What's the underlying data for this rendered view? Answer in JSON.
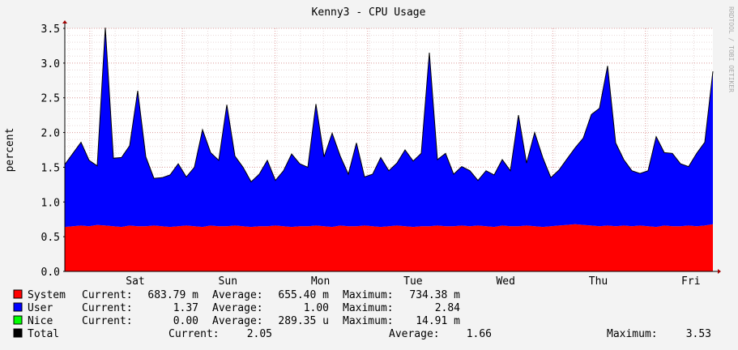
{
  "chart_data": {
    "type": "area",
    "title": "Kenny3 - CPU Usage",
    "ylabel": "percent",
    "watermark": "RRDTOOL / TOBI OETIKER",
    "ylim": [
      0,
      3.5
    ],
    "y_ticks": [
      "0.0",
      "0.5",
      "1.0",
      "1.5",
      "2.0",
      "2.5",
      "3.0",
      "3.5"
    ],
    "x_ticks": [
      "Sat",
      "Sun",
      "Mon",
      "Tue",
      "Wed",
      "Thu",
      "Fri"
    ],
    "grid": true,
    "stacked": true,
    "series": [
      {
        "name": "System",
        "color": "#ff0000",
        "current": "683.79 m",
        "average": "655.40 m",
        "maximum": "734.38 m",
        "values": [
          0.64,
          0.65,
          0.66,
          0.65,
          0.67,
          0.66,
          0.65,
          0.64,
          0.66,
          0.65,
          0.65,
          0.66,
          0.65,
          0.64,
          0.65,
          0.66,
          0.65,
          0.64,
          0.66,
          0.65,
          0.65,
          0.66,
          0.65,
          0.64,
          0.65,
          0.65,
          0.66,
          0.65,
          0.64,
          0.65,
          0.65,
          0.66,
          0.65,
          0.64,
          0.66,
          0.65,
          0.65,
          0.66,
          0.65,
          0.64,
          0.65,
          0.66,
          0.65,
          0.64,
          0.65,
          0.65,
          0.66,
          0.65,
          0.65,
          0.66,
          0.65,
          0.66,
          0.65,
          0.64,
          0.66,
          0.65,
          0.65,
          0.66,
          0.65,
          0.64,
          0.65,
          0.66,
          0.67,
          0.68,
          0.67,
          0.66,
          0.65,
          0.66,
          0.65,
          0.66,
          0.65,
          0.66,
          0.65,
          0.64,
          0.66,
          0.65,
          0.65,
          0.66,
          0.65,
          0.66,
          0.68
        ]
      },
      {
        "name": "User",
        "color": "#0000ff",
        "current": "1.37",
        "average": "1.00",
        "maximum": "2.84",
        "values": [
          0.9,
          1.05,
          1.2,
          0.95,
          0.85,
          2.85,
          0.98,
          1.0,
          1.15,
          1.95,
          1.0,
          0.68,
          0.7,
          0.75,
          0.9,
          0.7,
          0.85,
          1.4,
          1.05,
          0.95,
          1.75,
          1.0,
          0.85,
          0.65,
          0.75,
          0.95,
          0.65,
          0.8,
          1.05,
          0.9,
          0.85,
          1.75,
          1.0,
          1.35,
          1.0,
          0.75,
          1.2,
          0.7,
          0.75,
          1.0,
          0.8,
          0.9,
          1.1,
          0.95,
          1.05,
          2.5,
          0.95,
          1.05,
          0.75,
          0.85,
          0.8,
          0.65,
          0.8,
          0.75,
          0.95,
          0.8,
          1.6,
          0.9,
          1.35,
          1.0,
          0.7,
          0.8,
          0.95,
          1.1,
          1.25,
          1.6,
          1.7,
          2.3,
          1.2,
          0.95,
          0.8,
          0.75,
          0.8,
          1.3,
          1.05,
          1.05,
          0.9,
          0.85,
          1.05,
          1.2,
          2.2
        ]
      },
      {
        "name": "Nice",
        "color": "#00ff00",
        "current": "0.00",
        "average": "289.35 u",
        "maximum": "14.91 m",
        "values": [
          0,
          0,
          0,
          0,
          0,
          0,
          0,
          0,
          0,
          0,
          0,
          0,
          0,
          0,
          0,
          0,
          0,
          0,
          0,
          0,
          0,
          0,
          0,
          0,
          0,
          0,
          0,
          0,
          0,
          0,
          0,
          0,
          0,
          0,
          0,
          0,
          0,
          0,
          0,
          0,
          0,
          0,
          0,
          0,
          0,
          0,
          0,
          0,
          0,
          0,
          0,
          0,
          0,
          0,
          0,
          0,
          0,
          0,
          0,
          0,
          0,
          0,
          0,
          0,
          0,
          0,
          0,
          0,
          0,
          0,
          0,
          0,
          0,
          0,
          0,
          0,
          0,
          0,
          0,
          0,
          0
        ]
      },
      {
        "name": "Total",
        "color": "#000000",
        "current": "2.05",
        "average": "1.66",
        "maximum": "3.53"
      }
    ],
    "legend_labels": {
      "current": "Current:",
      "average": "Average:",
      "maximum": "Maximum:"
    },
    "legend_placement": "bottom"
  }
}
